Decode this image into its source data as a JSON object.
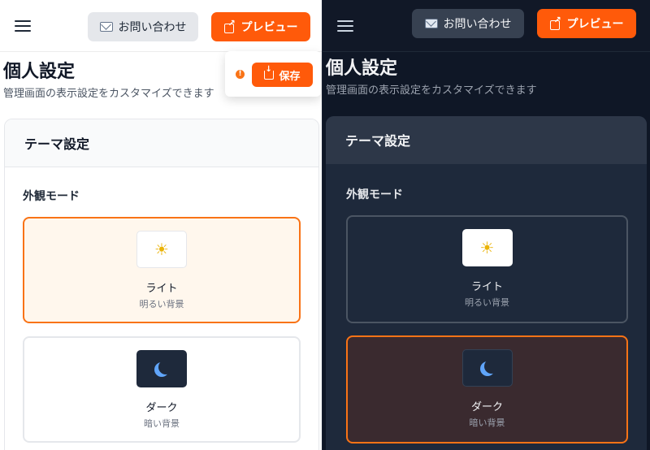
{
  "header": {
    "contact_label": "お問い合わせ",
    "preview_label": "プレビュー"
  },
  "page": {
    "title": "個人設定",
    "description": "管理画面の表示設定をカスタマイズできます"
  },
  "save": {
    "label": "保存",
    "warning_symbol": "!"
  },
  "theme_card": {
    "title": "テーマ設定",
    "section_label": "外観モード",
    "options": [
      {
        "label": "ライト",
        "sub": "明るい背景",
        "icon": "sun-icon"
      },
      {
        "label": "ダーク",
        "sub": "暗い背景",
        "icon": "moon-icon"
      }
    ]
  },
  "panels": [
    {
      "theme": "light",
      "selected_option": "ライト"
    },
    {
      "theme": "dark",
      "selected_option": "ダーク"
    }
  ],
  "colors": {
    "accent": "#ff5a0a",
    "selected_border": "#f97316",
    "dark_background": "#0f1726",
    "dark_card": "#1e293b"
  }
}
